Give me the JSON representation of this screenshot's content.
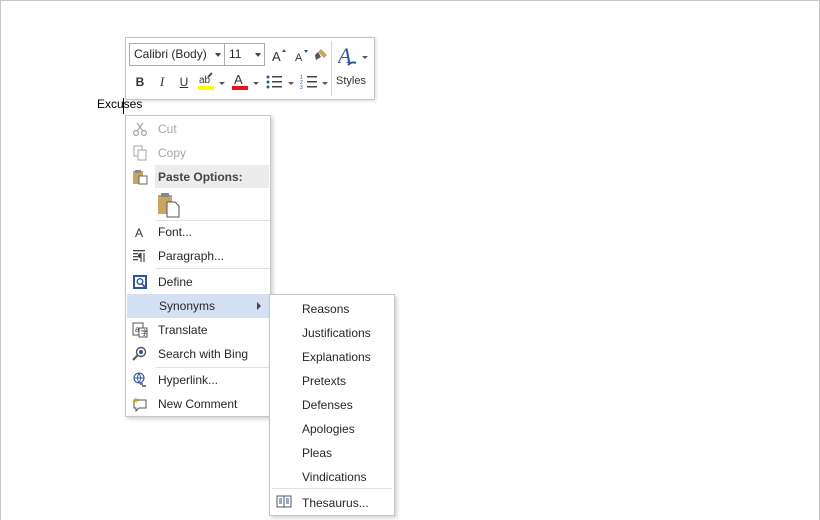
{
  "document": {
    "word": "Excuses"
  },
  "mini_toolbar": {
    "font_name": "Calibri (Body)",
    "font_size": "11",
    "styles_label": "Styles",
    "highlight_color": "#ffff00",
    "font_color": "#e81123"
  },
  "context_menu": {
    "cut": "Cut",
    "copy": "Copy",
    "paste_options": "Paste Options:",
    "font": "Font...",
    "paragraph": "Paragraph...",
    "define": "Define",
    "synonyms": "Synonyms",
    "translate": "Translate",
    "search_with_bing": "Search with Bing",
    "hyperlink": "Hyperlink...",
    "new_comment": "New Comment"
  },
  "synonyms_submenu": {
    "items": [
      "Reasons",
      "Justifications",
      "Explanations",
      "Pretexts",
      "Defenses",
      "Apologies",
      "Pleas",
      "Vindications"
    ],
    "thesaurus": "Thesaurus..."
  },
  "colors": {
    "highlight_bg": "#d5e1f2",
    "accent_blue": "#2b579a"
  }
}
